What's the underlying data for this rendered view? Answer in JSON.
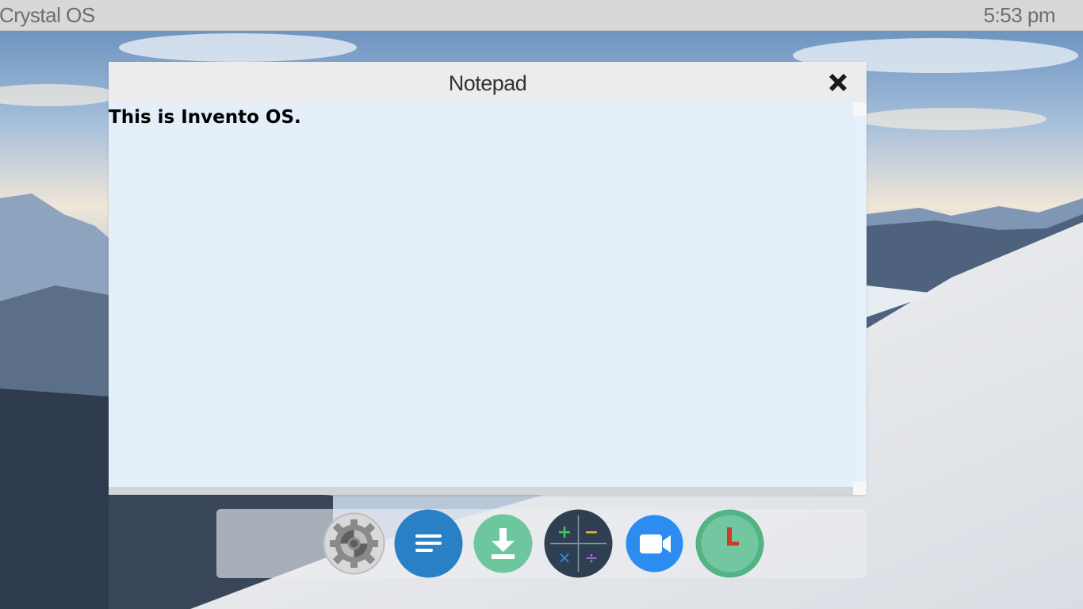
{
  "topbar": {
    "os_name": "Crystal OS",
    "clock": "5:53 pm"
  },
  "window": {
    "title": "Notepad",
    "close_icon": "close-icon",
    "content": "This is Invento OS."
  },
  "dock": {
    "apps": [
      {
        "name": "settings",
        "icon": "gear-icon"
      },
      {
        "name": "notepad",
        "icon": "notes-icon"
      },
      {
        "name": "downloads",
        "icon": "download-icon"
      },
      {
        "name": "calculator",
        "icon": "calculator-icon"
      },
      {
        "name": "video",
        "icon": "video-camera-icon"
      },
      {
        "name": "clock",
        "icon": "clock-icon"
      }
    ]
  },
  "colors": {
    "topbar_bg": "#d8d8d8",
    "editor_bg": "#e4effa",
    "notes_blue": "#2a80c4",
    "download_green": "#6cc79f",
    "calc_dark": "#2f3e50",
    "video_blue": "#2d8cf0",
    "clock_green": "#54b384"
  }
}
